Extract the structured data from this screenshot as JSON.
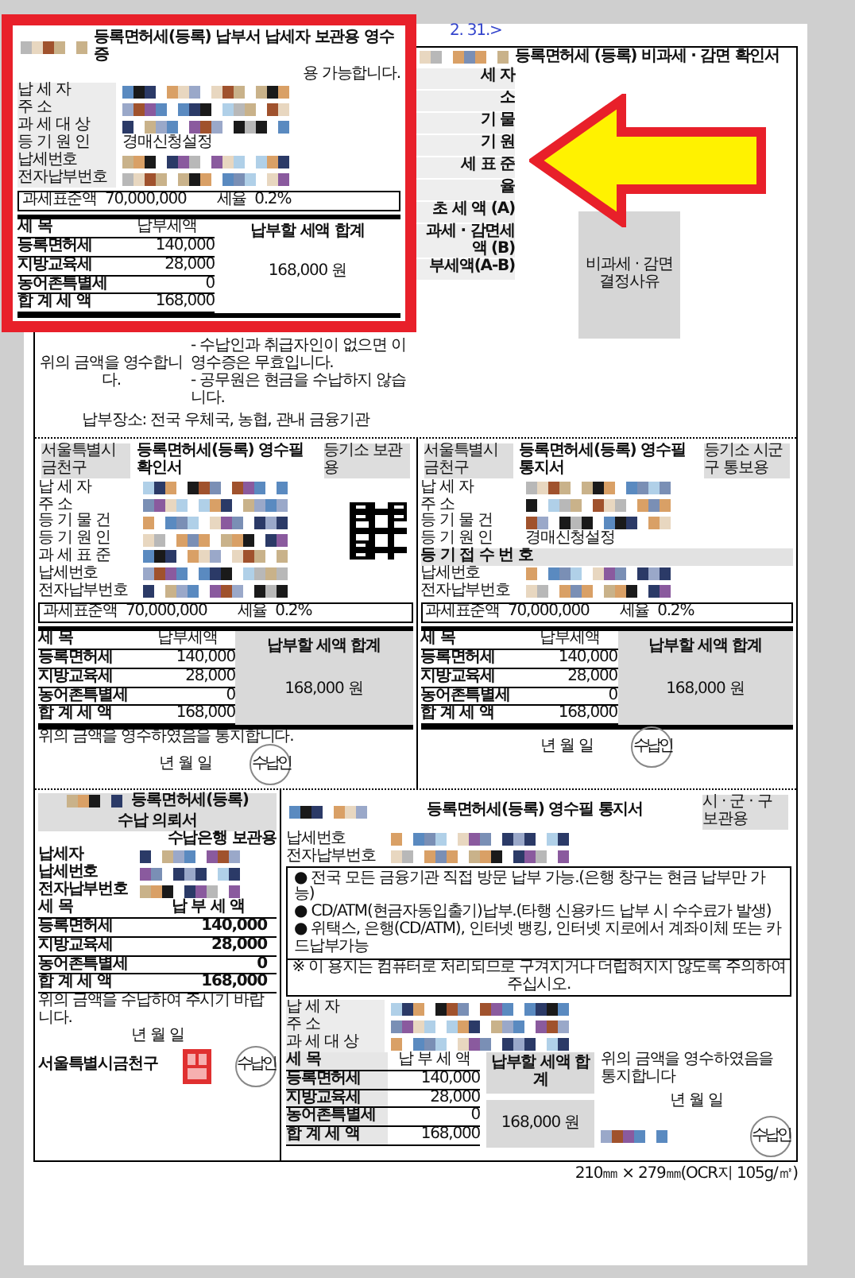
{
  "viewer": {
    "page_ref": "2. 31.>"
  },
  "taxpayer_receipt": {
    "title": "등록면허세(등록) 납부서 납세자 보관용 영수증",
    "note_fragment": "용 가능합니다.",
    "fields": [
      {
        "label": "납 세 자",
        "kind": "redacted"
      },
      {
        "label": "주 소",
        "kind": "redacted"
      },
      {
        "label": "과 세 대 상",
        "kind": "redacted"
      },
      {
        "label": "등 기 원 인",
        "kind": "text",
        "value": "경매신청설정"
      },
      {
        "label": "납세번호",
        "kind": "redacted"
      },
      {
        "label": "전자납부번호",
        "kind": "redacted"
      }
    ],
    "base": {
      "label": "과세표준액",
      "value": "70,000,000",
      "rate_label": "세율",
      "rate": "0.2%"
    },
    "items_header": [
      "세 목",
      "납부세액"
    ],
    "items": [
      {
        "name": "등록면허세",
        "amount": "140,000"
      },
      {
        "name": "지방교육세",
        "amount": "28,000"
      },
      {
        "name": "농어촌특별세",
        "amount": "0"
      },
      {
        "name": "합 계 세 액",
        "amount": "168,000"
      }
    ],
    "total_label": "납부할 세액 합계",
    "total": "168,000 원",
    "notes": [
      "- 수납인과 취급자인이 없으면 이 영수증은 무효입니다.",
      "- 공무원은 현금을 수납하지 않습니다."
    ],
    "received": "위의 금액을 영수합니다.",
    "place": "납부장소: 전국 우체국, 농협, 관내 금융기관"
  },
  "exemption": {
    "title": "등록면허세 (등록) 비과세 · 감면 확인서",
    "labels": [
      "세 자",
      "소",
      "기 물",
      "기 원",
      "세 표 준",
      "율",
      "초 세 액 (A)",
      "과세 · 감면세액 (B)",
      "부세액(A-B)"
    ],
    "reason": "비과세 · 감면 결정사유"
  },
  "confirmation": {
    "office": "서울특별시금천구",
    "title": "등록면허세(등록) 영수필 확인서",
    "copy": "등기소 보관용",
    "fields": [
      {
        "label": "납 세 자",
        "kind": "redacted"
      },
      {
        "label": "주 소",
        "kind": "redacted"
      },
      {
        "label": "등 기 물 건",
        "kind": "redacted"
      },
      {
        "label": "등 기 원 인",
        "kind": "redacted"
      },
      {
        "label": "과 세 표 준",
        "kind": "redacted"
      },
      {
        "label": "납세번호",
        "kind": "redacted"
      },
      {
        "label": "전자납부번호",
        "kind": "redacted"
      }
    ],
    "base": {
      "label": "과세표준액",
      "value": "70,000,000",
      "rate_label": "세율",
      "rate": "0.2%"
    },
    "items_header": [
      "세 목",
      "납부세액"
    ],
    "items": [
      {
        "name": "등록면허세",
        "amount": "140,000"
      },
      {
        "name": "지방교육세",
        "amount": "28,000"
      },
      {
        "name": "농어촌특별세",
        "amount": "0"
      },
      {
        "name": "합 계 세 액",
        "amount": "168,000"
      }
    ],
    "total_label": "납부할 세액 합계",
    "total": "168,000 원",
    "received": "위의 금액을 영수하였음을 통지합니다.",
    "date": "년 월 일",
    "stamp": "수납인"
  },
  "notice": {
    "office": "서울특별시금천구",
    "title": "등록면허세(등록) 영수필 통지서",
    "copy": "등기소 시군구 통보용",
    "fields": [
      {
        "label": "납 세 자",
        "kind": "redacted"
      },
      {
        "label": "주 소",
        "kind": "redacted"
      },
      {
        "label": "등 기 물 건",
        "kind": "redacted"
      },
      {
        "label": "등 기 원 인",
        "kind": "text",
        "value": "경매신청설정"
      },
      {
        "label": "등 기 접 수 번 호",
        "kind": "heading"
      },
      {
        "label": "납세번호",
        "kind": "redacted"
      },
      {
        "label": "전자납부번호",
        "kind": "redacted"
      }
    ],
    "base": {
      "label": "과세표준액",
      "value": "70,000,000",
      "rate_label": "세율",
      "rate": "0.2%"
    },
    "items_header": [
      "세 목",
      "납부세액"
    ],
    "items": [
      {
        "name": "등록면허세",
        "amount": "140,000"
      },
      {
        "name": "지방교육세",
        "amount": "28,000"
      },
      {
        "name": "농어촌특별세",
        "amount": "0"
      },
      {
        "name": "합 계 세 액",
        "amount": "168,000"
      }
    ],
    "total_label": "납부할 세액 합계",
    "total": "168,000 원",
    "date": "년 월 일",
    "stamp": "수납인"
  },
  "bank_request": {
    "title": "등록면허세(등록)",
    "subtitle": "수납 의뢰서",
    "copy": "수납은행 보관용",
    "fields": [
      {
        "label": "납세자",
        "kind": "redacted"
      },
      {
        "label": "납세번호",
        "kind": "redacted"
      },
      {
        "label": "전자납부번호",
        "kind": "redacted"
      }
    ],
    "items_header": [
      "세 목",
      "납 부 세 액"
    ],
    "items": [
      {
        "name": "등록면허세",
        "amount": "140,000"
      },
      {
        "name": "지방교육세",
        "amount": "28,000"
      },
      {
        "name": "농어촌특별세",
        "amount": "0"
      },
      {
        "name": "합 계 세 액",
        "amount": "168,000"
      }
    ],
    "request": "위의 금액을 수납하여 주시기 바랍니다.",
    "date": "년 월 일",
    "office": "서울특별시금천구",
    "stamp": "수납인"
  },
  "city_notice": {
    "title": "등록면허세(등록) 영수필 통지서",
    "copy": "시 · 군 · 구 보관용",
    "ids": [
      {
        "label": "납세번호",
        "kind": "redacted"
      },
      {
        "label": "전자납부번호",
        "kind": "redacted"
      }
    ],
    "bullets": [
      "● 전국 모든 금융기관 직접 방문 납부 가능.(은행 창구는 현금 납부만 가능)",
      "● CD/ATM(현금자동입출기)납부.(타행 신용카드 납부 시 수수료가 발생)",
      "● 위택스, 은행(CD/ATM), 인터넷 뱅킹, 인터넷 지로에서 계좌이체 또는 카드납부가능"
    ],
    "caution": "※ 이 용지는 컴퓨터로 처리되므로 구겨지거나 더럽혀지지 않도록 주의하여 주십시오.",
    "fields": [
      {
        "label": "납 세 자",
        "kind": "redacted"
      },
      {
        "label": "주 소",
        "kind": "redacted"
      },
      {
        "label": "과 세 대 상",
        "kind": "redacted"
      }
    ],
    "items_header": [
      "세 목",
      "납 부 세 액"
    ],
    "items": [
      {
        "name": "등록면허세",
        "amount": "140,000"
      },
      {
        "name": "지방교육세",
        "amount": "28,000"
      },
      {
        "name": "농어촌특별세",
        "amount": "0"
      },
      {
        "name": "합 계 세 액",
        "amount": "168,000"
      }
    ],
    "total_label": "납부할 세액 합계",
    "total": "168,000 원",
    "received": "위의 금액을 영수하였음을 통지합니다",
    "date": "년 월 일",
    "stamp": "수납인"
  },
  "footer": "210㎜ × 279㎜(OCR지 105g/㎡)"
}
